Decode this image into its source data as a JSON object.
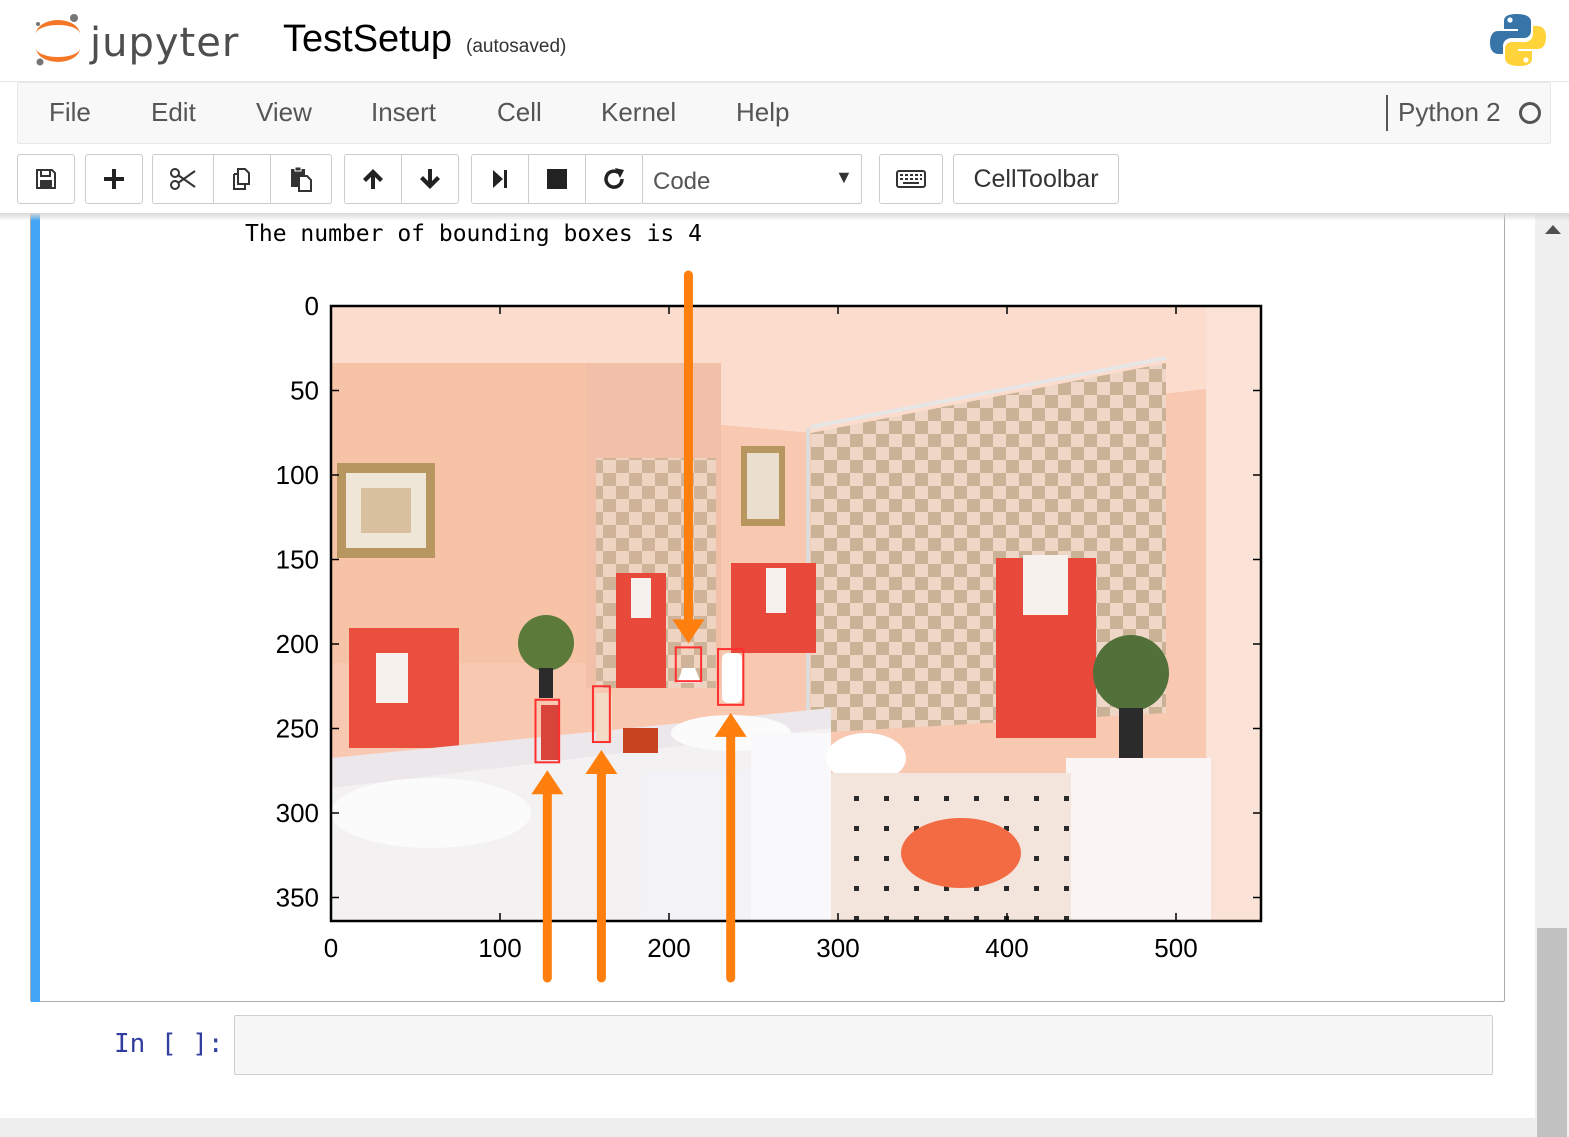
{
  "header": {
    "logo_text": "jupyter",
    "notebook_name": "TestSetup",
    "autosave_status": "(autosaved)",
    "kernel_logo_icon": "python-logo-icon"
  },
  "menubar": {
    "items": [
      "File",
      "Edit",
      "View",
      "Insert",
      "Cell",
      "Kernel",
      "Help"
    ],
    "kernel_name": "Python 2",
    "kernel_status_icon": "kernel-idle-circle-icon"
  },
  "toolbar": {
    "buttons": [
      "save-icon",
      "plus-icon",
      "cut-icon",
      "copy-icon",
      "paste-icon",
      "arrow-up-icon",
      "arrow-down-icon",
      "step-forward-icon",
      "stop-icon",
      "refresh-icon",
      "keyboard-icon"
    ],
    "cell_type": "Code",
    "celltoolbar_label": "CellToolbar"
  },
  "cells": {
    "output": {
      "text": "The number of bounding boxes is 4",
      "plot": {
        "x_ticks": [
          "0",
          "100",
          "200",
          "300",
          "400",
          "500"
        ],
        "y_ticks": [
          "0",
          "50",
          "100",
          "150",
          "200",
          "250",
          "300",
          "350"
        ],
        "xlim": [
          0,
          550
        ],
        "ylim": [
          0,
          365
        ],
        "image": "bathroom photo (pink walls, checkered tile shower, red towels, white vanity, orange round rug)",
        "bounding_boxes": [
          {
            "x": 121,
            "y": 233,
            "w": 14,
            "h": 37
          },
          {
            "x": 155,
            "y": 225,
            "w": 10,
            "h": 33
          },
          {
            "x": 204,
            "y": 202,
            "w": 15,
            "h": 20
          },
          {
            "x": 229,
            "y": 203,
            "w": 15,
            "h": 33
          }
        ],
        "annotation_color": "#ff7f0e",
        "box_color": "#ff3030"
      }
    },
    "next_prompt": "In [ ]:"
  }
}
